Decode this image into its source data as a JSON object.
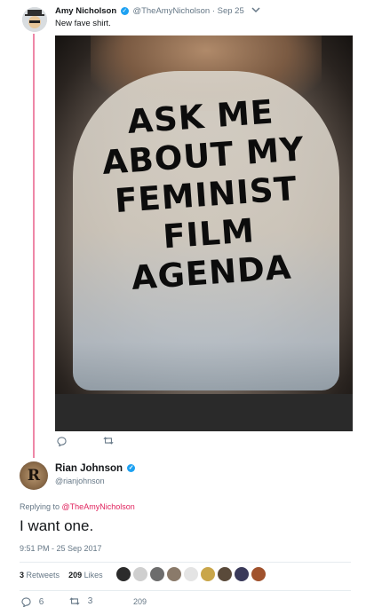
{
  "tweet1": {
    "name": "Amy Nicholson",
    "handle": "@TheAmyNicholson",
    "separator": "·",
    "time": "Sep 25",
    "text": "New fave shirt.",
    "shirt_text": [
      "ASK ME",
      "ABOUT MY",
      "FEMINIST",
      "FILM",
      "AGENDA"
    ],
    "icons": {
      "reply": "reply-icon",
      "retweet": "retweet-icon",
      "chevron": "chevron-down-icon"
    }
  },
  "tweet2": {
    "name": "Rian Johnson",
    "handle": "@rianjohnson",
    "avatar_letter": "R",
    "replying_prefix": "Replying to",
    "replying_to": "@TheAmyNicholson",
    "text": "I want one.",
    "timestamp": "9:51 PM - 25 Sep 2017",
    "retweets_count": "3",
    "retweets_label": "Retweets",
    "likes_count": "209",
    "likes_label": "Likes",
    "reply_count": "6",
    "retweet_count": "3",
    "like_count": "209"
  },
  "colors": {
    "accent": "#1da1f2",
    "mention": "#e0245e",
    "muted": "#657786"
  }
}
